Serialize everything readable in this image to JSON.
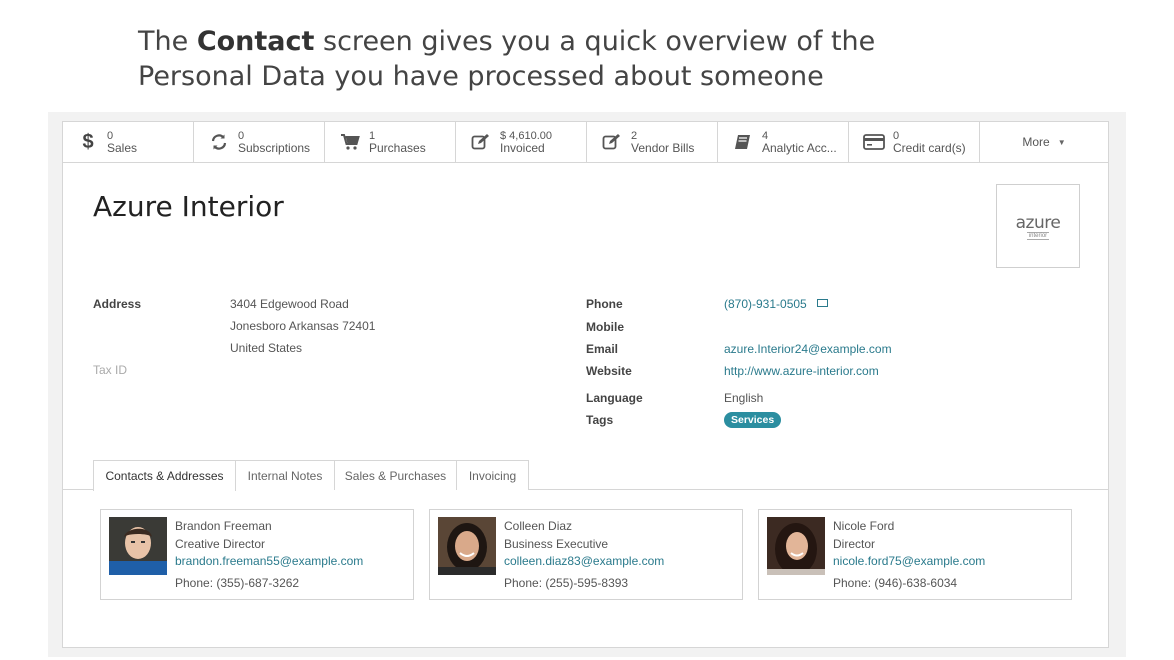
{
  "caption": {
    "line1_pre": "The ",
    "line1_bold": "Contact",
    "line1_post": " screen gives you a quick overview of the",
    "line2": "Personal Data you have processed about someone"
  },
  "smart_buttons": [
    {
      "icon": "dollar-icon",
      "value": "0",
      "label": "Sales"
    },
    {
      "icon": "refresh-icon",
      "value": "0",
      "label": "Subscriptions"
    },
    {
      "icon": "cart-icon",
      "value": "1",
      "label": "Purchases"
    },
    {
      "icon": "edit-icon",
      "value": "$ 4,610.00",
      "label": "Invoiced"
    },
    {
      "icon": "edit-icon",
      "value": "2",
      "label": "Vendor Bills"
    },
    {
      "icon": "book-icon",
      "value": "4",
      "label": "Analytic Acc..."
    },
    {
      "icon": "credit-card-icon",
      "value": "0",
      "label": "Credit card(s)"
    }
  ],
  "more_button": {
    "label": "More"
  },
  "record": {
    "name": "Azure Interior",
    "logo_word": "azure",
    "logo_sub": "interior"
  },
  "fields": {
    "address_label": "Address",
    "address_line1": "3404 Edgewood Road",
    "address_line2": "Jonesboro  Arkansas  72401",
    "address_line3": "United States",
    "taxid_label": "Tax ID",
    "phone_label": "Phone",
    "phone_value": "(870)-931-0505",
    "mobile_label": "Mobile",
    "email_label": "Email",
    "email_value": "azure.Interior24@example.com",
    "website_label": "Website",
    "website_value": "http://www.azure-interior.com",
    "language_label": "Language",
    "language_value": "English",
    "tags_label": "Tags",
    "tag_value": "Services"
  },
  "tabs": [
    {
      "label": "Contacts & Addresses"
    },
    {
      "label": "Internal Notes"
    },
    {
      "label": "Sales & Purchases"
    },
    {
      "label": "Invoicing"
    }
  ],
  "contacts": [
    {
      "name": "Brandon Freeman",
      "function": "Creative Director",
      "email": "brandon.freeman55@example.com",
      "phone": "Phone: (355)-687-3262"
    },
    {
      "name": "Colleen Diaz",
      "function": "Business Executive",
      "email": "colleen.diaz83@example.com",
      "phone": "Phone: (255)-595-8393"
    },
    {
      "name": "Nicole Ford",
      "function": "Director",
      "email": "nicole.ford75@example.com",
      "phone": "Phone: (946)-638-6034"
    }
  ],
  "colors": {
    "link": "#2a7a8c",
    "tag": "#2b8ea0",
    "border": "#d6d6d6"
  }
}
